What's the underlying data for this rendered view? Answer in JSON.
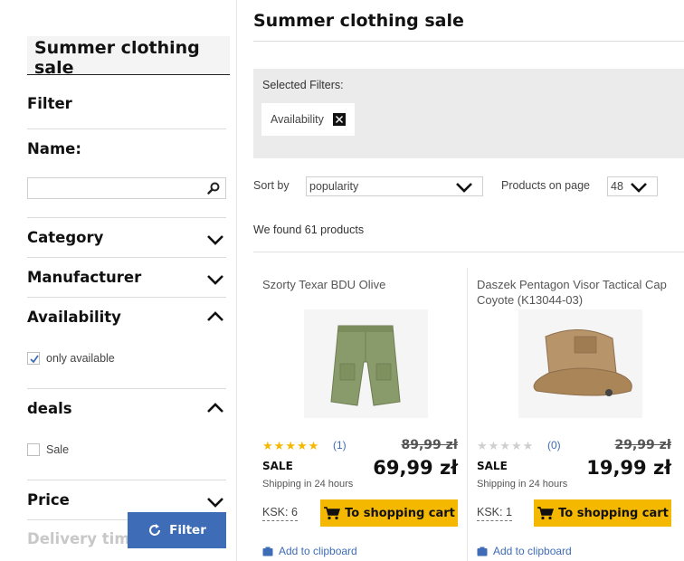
{
  "sidebar": {
    "title": "Summer clothing sale",
    "filter_heading": "Filter",
    "name_label": "Name:",
    "name_value": "",
    "category_label": "Category",
    "manufacturer_label": "Manufacturer",
    "availability_label": "Availability",
    "only_available_label": "only available",
    "only_available_checked": true,
    "deals_label": "deals",
    "sale_label": "Sale",
    "sale_checked": false,
    "price_label": "Price",
    "delivery_label": "Delivery time",
    "filter_button": "Filter"
  },
  "main": {
    "title": "Summer clothing sale",
    "selected_filters_label": "Selected Filters:",
    "selected_filter_chip": "Availability",
    "sort_label": "Sort by",
    "sort_value": "popularity",
    "per_page_label": "Products on page",
    "per_page_value": "48",
    "found_text": "We found 61 products"
  },
  "products": [
    {
      "name": "Szorty Texar BDU Olive",
      "rating": 5,
      "review_count": "(1)",
      "old_price": "89,99 zł",
      "sale_label": "SALE",
      "price": "69,99 zł",
      "shipping": "Shipping in 24 hours",
      "ksk": "KSK: 6",
      "cart_label": "To shopping cart",
      "clipboard_label": "Add to clipboard",
      "image_icon": "shorts-image"
    },
    {
      "name": "Daszek Pentagon Visor Tactical Cap Coyote (K13044-03)",
      "rating": 0,
      "review_count": "(0)",
      "old_price": "29,99 zł",
      "sale_label": "SALE",
      "price": "19,99 zł",
      "shipping": "Shipping in 24 hours",
      "ksk": "KSK: 1",
      "cart_label": "To shopping cart",
      "clipboard_label": "Add to clipboard",
      "image_icon": "visor-cap-image"
    }
  ],
  "colors": {
    "accent_blue": "#3e6cb6",
    "cart_yellow": "#f5b800",
    "star_gold": "#f5b800",
    "star_empty": "#cfcfcf"
  }
}
